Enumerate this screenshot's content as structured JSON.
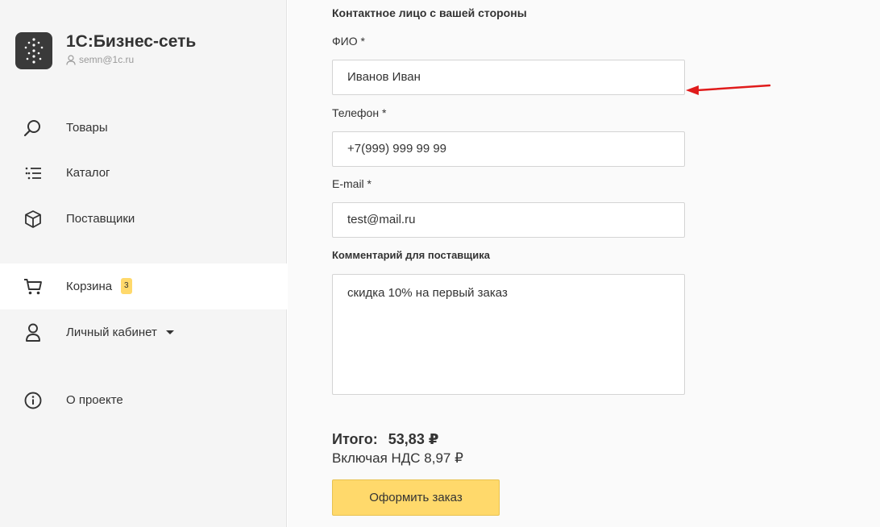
{
  "colors": {
    "accent": "#ffd96b",
    "annotation_arrow": "#e01b1b",
    "logo_bg": "#3a3a3a"
  },
  "sidebar": {
    "app_title": "1С:Бизнес-сеть",
    "user_email": "semn@1c.ru",
    "items": [
      {
        "label": "Товары",
        "icon": "search-icon"
      },
      {
        "label": "Каталог",
        "icon": "list-icon"
      },
      {
        "label": "Поставщики",
        "icon": "box-icon"
      },
      {
        "label": "Корзина",
        "icon": "cart-icon",
        "badge": "3",
        "active": true
      },
      {
        "label": "Личный кабинет",
        "icon": "user-icon",
        "dropdown": true
      },
      {
        "label": "О проекте",
        "icon": "info-icon"
      }
    ]
  },
  "form": {
    "section_title": "Контактное лицо с вашей стороны",
    "name": {
      "label": "ФИО *",
      "value": "Иванов Иван"
    },
    "phone": {
      "label": "Телефон *",
      "value": "+7(999) 999 99 99"
    },
    "email": {
      "label": "E-mail *",
      "value": "test@mail.ru"
    },
    "comment": {
      "label": "Комментарий для поставщика",
      "value": "скидка 10% на первый заказ"
    }
  },
  "summary": {
    "total_label": "Итого:",
    "total_value": "53,83 ₽",
    "vat_text": "Включая НДС 8,97 ₽",
    "order_button": "Оформить заказ"
  }
}
